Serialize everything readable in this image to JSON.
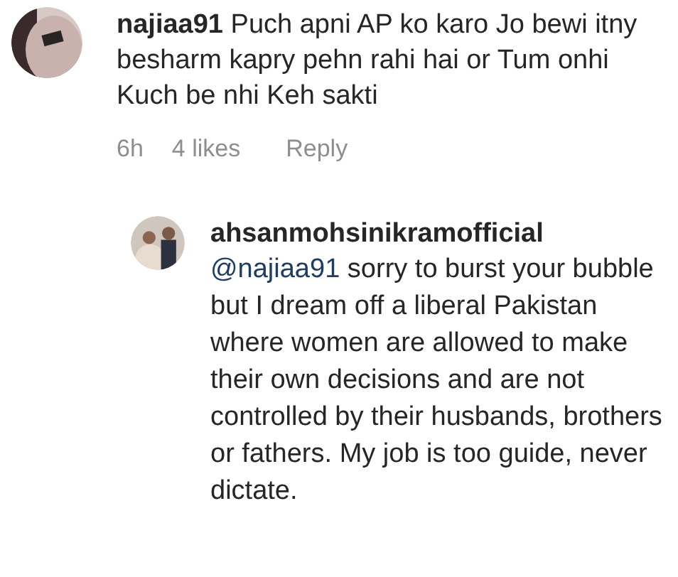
{
  "comments": [
    {
      "username": "najiaa91",
      "text": "Puch apni AP ko karo Jo bewi itny besharm kapry pehn rahi hai or Tum onhi Kuch be nhi Keh sakti",
      "time": "6h",
      "likes": "4 likes",
      "reply": "Reply",
      "replies": [
        {
          "username": "ahsanmohsinikramofficial",
          "mention": "@najiaa91",
          "text": "sorry to burst your bubble but I dream off a liberal Pakistan where women are allowed to make their own decisions and are not controlled by their husbands, brothers or fathers. My job is too guide, never dictate."
        }
      ]
    }
  ]
}
